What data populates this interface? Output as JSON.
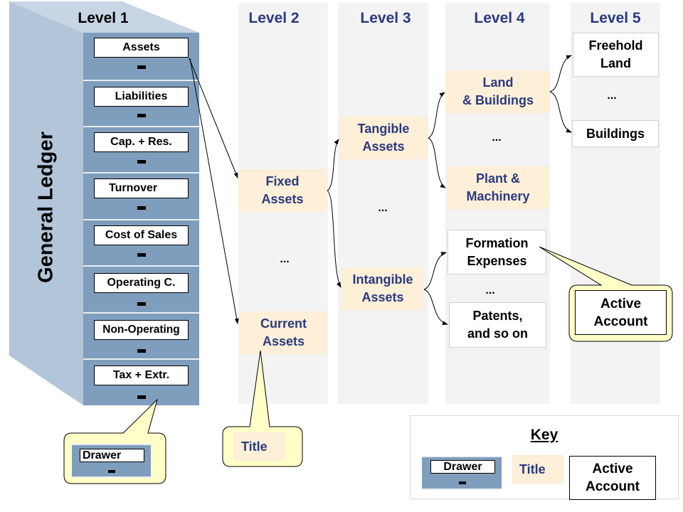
{
  "diagram": {
    "side_label": "General Ledger",
    "levels": [
      "Level 1",
      "Level 2",
      "Level 3",
      "Level 4",
      "Level 5"
    ],
    "level1_drawers": [
      "Assets",
      "Liabilities",
      "Cap. + Res.",
      "Turnover",
      "Cost of Sales",
      "Operating C.",
      "Non-Operating",
      "Tax + Extr."
    ],
    "level2": {
      "fixed_assets": "Fixed\nAssets",
      "ellipsis": "...",
      "current_assets": "Current\nAssets"
    },
    "level3": {
      "tangible_assets": "Tangible\nAssets",
      "ellipsis": "...",
      "intangible_assets": "Intangible\nAssets"
    },
    "level4": {
      "land_buildings": "Land\n& Buildings",
      "ellipsis_1": "...",
      "plant_machinery": "Plant &\nMachinery",
      "formation_expenses": "Formation\nExpenses",
      "ellipsis_2": "...",
      "patents": "Patents,\nand so on"
    },
    "level5": {
      "freehold_land": "Freehold\nLand",
      "ellipsis": "...",
      "buildings": "Buildings"
    },
    "callouts": {
      "drawer": "Drawer",
      "title": "Title",
      "active_account": "Active\nAccount"
    },
    "key": {
      "heading": "Key",
      "drawer": "Drawer",
      "title": "Title",
      "active_account": "Active\nAccount"
    }
  },
  "colors": {
    "drawer_blue": "#7f9dbc",
    "cabinet_side": "#b3c5d9",
    "title_fill": "#fdefd8",
    "title_text": "#2b3a80",
    "column_bg": "#f3f3f3",
    "callout_fill": "#ffffc8"
  }
}
